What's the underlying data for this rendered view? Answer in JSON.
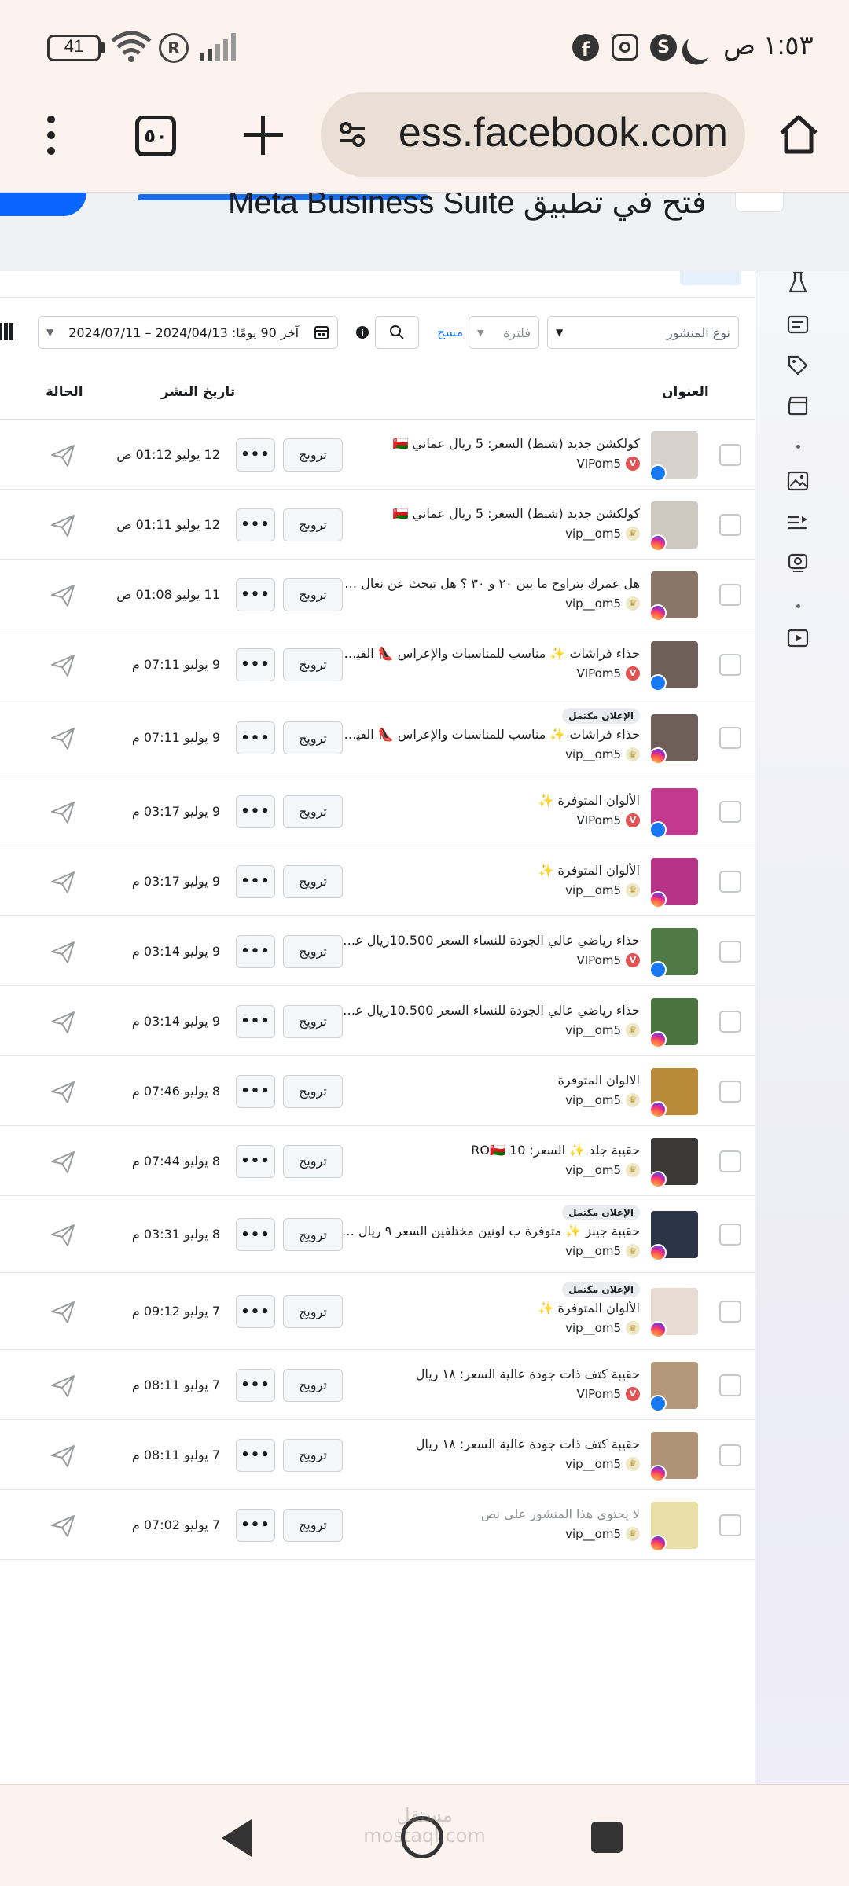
{
  "status_bar": {
    "time": "١:٥٣ ص",
    "battery": "41"
  },
  "browser": {
    "url": "ess.facebook.com",
    "tab_count": "٥٠"
  },
  "banner": {
    "text": "فتح في تطبيق Meta Business Suite"
  },
  "filters": {
    "post_type_placeholder": "نوع المنشور",
    "filter_label": "فلترة",
    "clear_label": "مسح",
    "date_range": "آخر 90 يومًا: 2024/04/13 – 2024/07/11"
  },
  "columns": {
    "title": "العنوان",
    "publish_date": "تاريخ النشر",
    "status": "الحالة"
  },
  "row_labels": {
    "promote": "ترويج",
    "more": "•••",
    "ad_complete": "الإعلان مكتمل"
  },
  "posts": [
    {
      "caption": "كولكشن جديد (شنط) السعر: 5 ريال عماني 🇴🇲",
      "account": "VIPom5",
      "platform": "facebook",
      "date": "12 يوليو 01:12 ص",
      "ad_complete": false,
      "thumb_color": "#d8d2cc"
    },
    {
      "caption": "كولكشن جديد (شنط) السعر: 5 ريال عماني 🇴🇲",
      "account": "vip__om5",
      "platform": "instagram",
      "date": "12 يوليو 01:11 ص",
      "ad_complete": false,
      "thumb_color": "#cfc8c1"
    },
    {
      "caption": "هل عمرك يتراوح ما بين ٢٠ و ٣٠ ؟ هل تبحث عن نعال (كعب...",
      "account": "vip__om5",
      "platform": "instagram",
      "date": "11 يوليو 01:08 ص",
      "ad_complete": false,
      "thumb_color": "#8a7568"
    },
    {
      "caption": "حذاء فراشات ✨ مناسب للمناسبات والإعراس 👠 القياسا...",
      "account": "VIPom5",
      "platform": "facebook",
      "date": "9 يوليو 07:11 م",
      "ad_complete": false,
      "thumb_color": "#6e5f58"
    },
    {
      "caption": "حذاء فراشات ✨ مناسب للمناسبات والإعراس 👠 القياسا...",
      "account": "vip__om5",
      "platform": "instagram",
      "date": "9 يوليو 07:11 م",
      "ad_complete": true,
      "thumb_color": "#6e5f58"
    },
    {
      "caption": "الألوان المتوفرة ✨",
      "account": "VIPom5",
      "platform": "facebook",
      "date": "9 يوليو 03:17 م",
      "ad_complete": false,
      "thumb_color": "#c13a8f"
    },
    {
      "caption": "الألوان المتوفرة ✨",
      "account": "vip__om5",
      "platform": "instagram",
      "date": "9 يوليو 03:17 م",
      "ad_complete": false,
      "thumb_color": "#b53488"
    },
    {
      "caption": "حذاء رياضي عالي الجودة للنساء السعر 10.500ريال عماني...",
      "account": "VIPom5",
      "platform": "facebook",
      "date": "9 يوليو 03:14 م",
      "ad_complete": false,
      "thumb_color": "#4f7a45"
    },
    {
      "caption": "حذاء رياضي عالي الجودة للنساء السعر 10.500ريال عماني...",
      "account": "vip__om5",
      "platform": "instagram",
      "date": "9 يوليو 03:14 م",
      "ad_complete": false,
      "thumb_color": "#4a7340"
    },
    {
      "caption": "الالوان المتوفرة",
      "account": "vip__om5",
      "platform": "instagram",
      "date": "8 يوليو 07:46 م",
      "ad_complete": false,
      "thumb_color": "#b88a3a"
    },
    {
      "caption": "حقيبة جلد ✨ السعر: 10 RO🇴🇲",
      "account": "vip__om5",
      "platform": "instagram",
      "date": "8 يوليو 07:44 م",
      "ad_complete": false,
      "thumb_color": "#3b3838"
    },
    {
      "caption": "حقيبة جينز ✨ متوفرة ب لونين مختلفين السعر ٩ ريال عما...",
      "account": "vip__om5",
      "platform": "instagram",
      "date": "8 يوليو 03:31 م",
      "ad_complete": true,
      "thumb_color": "#2c3548"
    },
    {
      "caption": "الألوان المتوفرة ✨",
      "account": "vip__om5",
      "platform": "instagram",
      "date": "7 يوليو 09:12 م",
      "ad_complete": true,
      "thumb_color": "#e8dcd2"
    },
    {
      "caption": "حقيبة كتف ذات جودة عالية السعر: ١٨ ريال",
      "account": "VIPom5",
      "platform": "facebook",
      "date": "7 يوليو 08:11 م",
      "ad_complete": false,
      "thumb_color": "#b5977a"
    },
    {
      "caption": "حقيبة كتف ذات جودة عالية السعر: ١٨ ريال",
      "account": "vip__om5",
      "platform": "instagram",
      "date": "7 يوليو 08:11 م",
      "ad_complete": false,
      "thumb_color": "#b09275"
    },
    {
      "caption": "لا يحتوي هذا المنشور على نص",
      "account": "vip__om5",
      "platform": "instagram",
      "date": "7 يوليو 07:02 م",
      "ad_complete": false,
      "thumb_color": "#e9e0a8",
      "muted": true
    }
  ],
  "watermark": "مستقل mostaql.com"
}
